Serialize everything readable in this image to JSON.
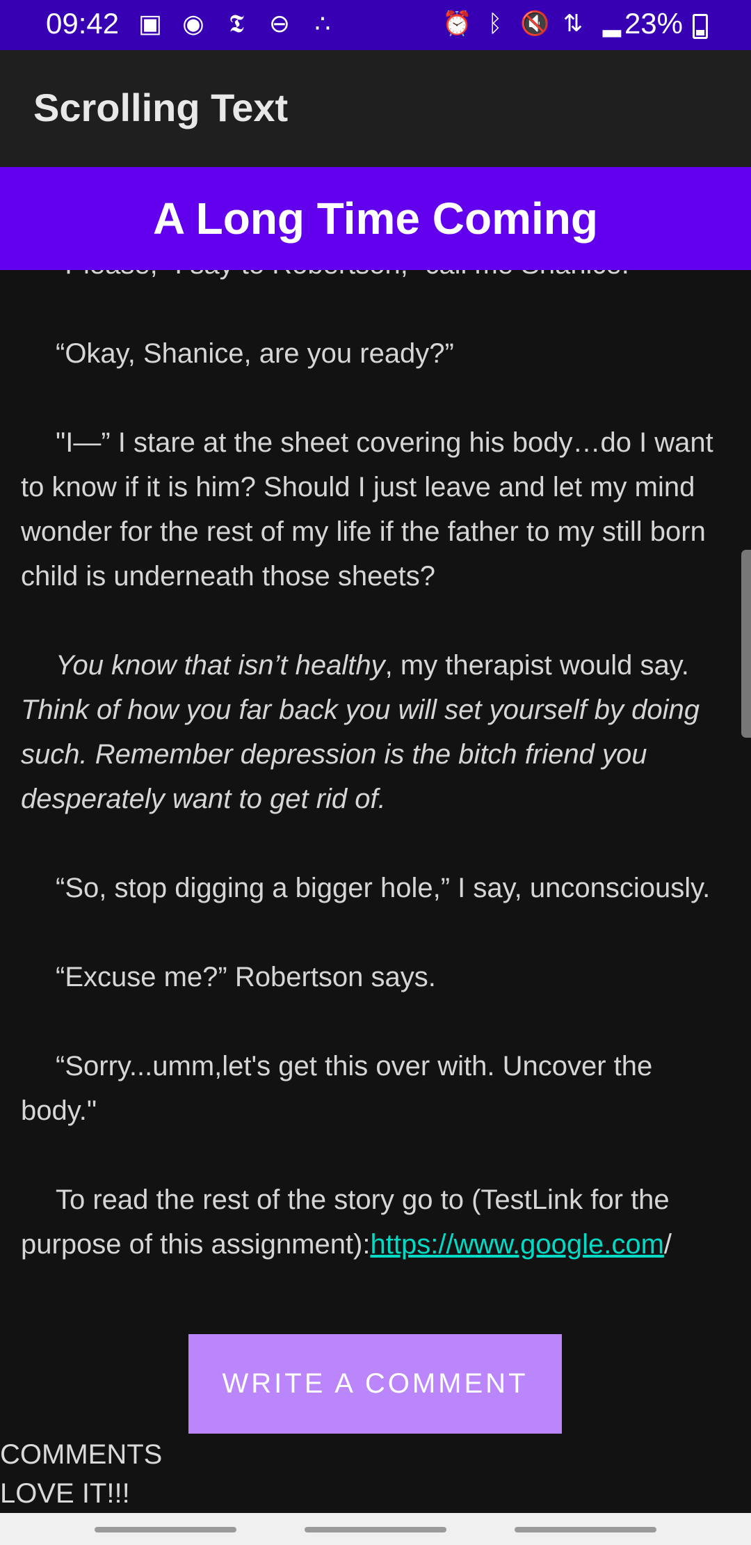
{
  "status_bar": {
    "time": "09:42",
    "battery_percent": "23%",
    "left_icons": [
      "news-icon",
      "broadcast-icon",
      "nyt-icon",
      "do-not-disturb-icon",
      "dots-icon"
    ],
    "right_icons": [
      "alarm-icon",
      "bluetooth-icon",
      "mute-icon",
      "network-4g-icon",
      "signal-icon"
    ]
  },
  "app_bar": {
    "title": "Scrolling Text"
  },
  "story": {
    "title": "A Long Time Coming",
    "paragraphs": {
      "p0": "“Please,” I say to Robertson, “call me Shanice.”",
      "p1": "“Okay, Shanice, are you ready?”",
      "p2": "\"I—” I stare at the sheet covering his body…do I want to know if it is him? Should I just leave and let my mind wonder for the rest of my life if the father to my still born child is underneath those sheets?",
      "p3_italic_a": "You know that isn’t healthy",
      "p3_normal": ", my therapist would say. ",
      "p3_italic_b": "Think of how you far back you will set yourself by doing such. Remember depression is the bitch friend you desperately want to get rid of.",
      "p4": "“So, stop digging a bigger hole,” I say, unconsciously.",
      "p5": "“Excuse me?” Robertson says.",
      "p6": "“Sorry...umm,let's get this over with. Uncover the body.\"",
      "p7": "To read the rest of the story go to (TestLink for the purpose of this assignment):",
      "link": "https://www.google.com",
      "link_suffix": "/"
    }
  },
  "actions": {
    "write_comment_label": "WRITE A COMMENT"
  },
  "comments": {
    "heading": "COMMENTS",
    "items": [
      "LOVE IT!!!"
    ]
  },
  "colors": {
    "status_bar": "#3700b3",
    "title_bar": "#6200ee",
    "button": "#bb86fc",
    "link": "#03dac5",
    "background": "#121212"
  }
}
